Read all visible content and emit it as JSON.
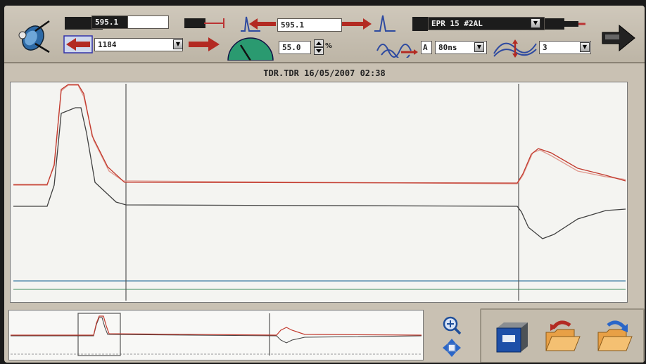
{
  "toolbar": {
    "cursor1_value": "595.1",
    "cursor2_value": "595.1",
    "cable_type": "EPR 15 #2AL",
    "range_value": "1184",
    "velocity_value": "55.0",
    "velocity_unit": "%",
    "amplitude_mode": "A",
    "pulse_width": "80ns",
    "gain_value": "3"
  },
  "trace": {
    "title": "TDR.TDR  16/05/2007  02:38"
  },
  "colors": {
    "trace_red": "#c23a2e",
    "trace_dark": "#404040",
    "trace_pink": "#e09a90",
    "baseline_blue": "#5a8fb0",
    "baseline_green": "#7bb08e"
  },
  "icons": {
    "probe": "probe-logo-icon",
    "next": "next-arrow-icon",
    "zoom_in": "zoom-in-icon",
    "pan": "pan-icon",
    "save": "save-disk-icon",
    "open": "open-folder-icon",
    "open_alt": "open-folder-redo-icon"
  }
}
